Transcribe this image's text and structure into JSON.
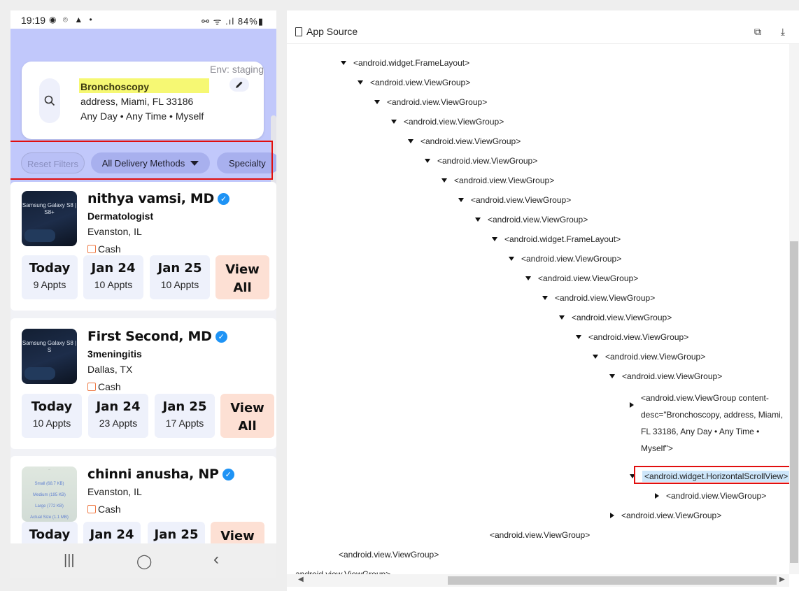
{
  "status_bar": {
    "time": "19:19",
    "left_icons": "◉ ⌾ ▲ •",
    "right_icons": "⚯ ᯤ .ıl 84%▮"
  },
  "search_card": {
    "env": "Env: staging",
    "procedure": "Bronchoscopy",
    "address": "address,  Miami, FL 33186",
    "when": "Any Day • Any Time • Myself"
  },
  "filters": {
    "reset": "Reset Filters",
    "delivery": "All Delivery Methods",
    "specialty": "Specialty"
  },
  "providers": [
    {
      "name": "nithya vamsi, MD",
      "specialty": "Dermatologist",
      "location": "Evanston, IL",
      "payment": "Cash",
      "thumb_text": "Samsung Galaxy S8 | S8+",
      "slots": [
        {
          "day": "Today",
          "appts": "9 Appts"
        },
        {
          "day": "Jan 24",
          "appts": "10 Appts"
        },
        {
          "day": "Jan 25",
          "appts": "10 Appts"
        }
      ],
      "view_all": [
        "View",
        "All"
      ]
    },
    {
      "name": "First Second, MD",
      "specialty": "3meningitis",
      "location": "Dallas, TX",
      "payment": "Cash",
      "thumb_text": "Samsung Galaxy S8 | S",
      "slots": [
        {
          "day": "Today",
          "appts": "10 Appts"
        },
        {
          "day": "Jan 24",
          "appts": "23 Appts"
        },
        {
          "day": "Jan 25",
          "appts": "17 Appts"
        }
      ],
      "view_all": [
        "View",
        "All"
      ]
    },
    {
      "name": "chinni anusha, NP",
      "specialty": "",
      "location": "Evanston, IL",
      "payment": "Cash",
      "thumb_rows": [
        "Small (68.7 KB)",
        "Medium (195 KB)",
        "Large (772 KB)",
        "Actual Size (1.1 MB)"
      ],
      "slots": [
        {
          "day": "Today",
          "appts": ""
        },
        {
          "day": "Jan 24",
          "appts": ""
        },
        {
          "day": "Jan 25",
          "appts": ""
        }
      ],
      "view_all": [
        "View",
        ""
      ]
    }
  ],
  "nav": {
    "recents": "|||",
    "home": "◯",
    "back": "‹"
  },
  "source_panel": {
    "title": "App Source",
    "actions": "⧉ ⤓",
    "nodes": [
      {
        "text": "<android.widget.FrameLayout>",
        "toggle": "down"
      },
      {
        "text": "<android.view.ViewGroup>",
        "toggle": "down"
      },
      {
        "text": "<android.view.ViewGroup>",
        "toggle": "down"
      },
      {
        "text": "<android.view.ViewGroup>",
        "toggle": "down"
      },
      {
        "text": "<android.view.ViewGroup>",
        "toggle": "down"
      },
      {
        "text": "<android.view.ViewGroup>",
        "toggle": "down"
      },
      {
        "text": "<android.view.ViewGroup>",
        "toggle": "down"
      },
      {
        "text": "<android.view.ViewGroup>",
        "toggle": "down"
      },
      {
        "text": "<android.view.ViewGroup>",
        "toggle": "down"
      },
      {
        "text": "<android.widget.FrameLayout>",
        "toggle": "down"
      },
      {
        "text": "<android.view.ViewGroup>",
        "toggle": "down"
      },
      {
        "text": "<android.view.ViewGroup>",
        "toggle": "down"
      },
      {
        "text": "<android.view.ViewGroup>",
        "toggle": "down"
      },
      {
        "text": "<android.view.ViewGroup>",
        "toggle": "down"
      },
      {
        "text": "<android.view.ViewGroup>",
        "toggle": "down"
      },
      {
        "text": "<android.view.ViewGroup>",
        "toggle": "down"
      },
      {
        "text": "<android.view.ViewGroup>",
        "toggle": "down"
      }
    ],
    "content_node": {
      "tag": "<android.view.ViewGroup ",
      "attr": "content-desc",
      "value": "=\"Bronchoscopy, address, Miami, FL 33186, Any Day • Any Time • Myself\">"
    },
    "selected_node": "<android.widget.HorizontalScrollView>",
    "tail_nodes": [
      {
        "text": "<android.view.ViewGroup>",
        "toggle": "right"
      },
      {
        "text": "<android.view.ViewGroup>",
        "toggle": "right"
      },
      {
        "text": "<android.view.ViewGroup>",
        "toggle": ""
      },
      {
        "text": "<android.view.ViewGroup>",
        "toggle": ""
      },
      {
        "text": "android.view.ViewGroup>",
        "toggle": ""
      }
    ]
  },
  "colors": {
    "hero_bg": "#c1c8fb",
    "highlight_border": "#e10e0e",
    "procedure_highlight": "#f6f873",
    "verified_badge": "#1e93f5",
    "view_all_bg": "#fde0d4",
    "slot_bg": "#eef1fb"
  }
}
